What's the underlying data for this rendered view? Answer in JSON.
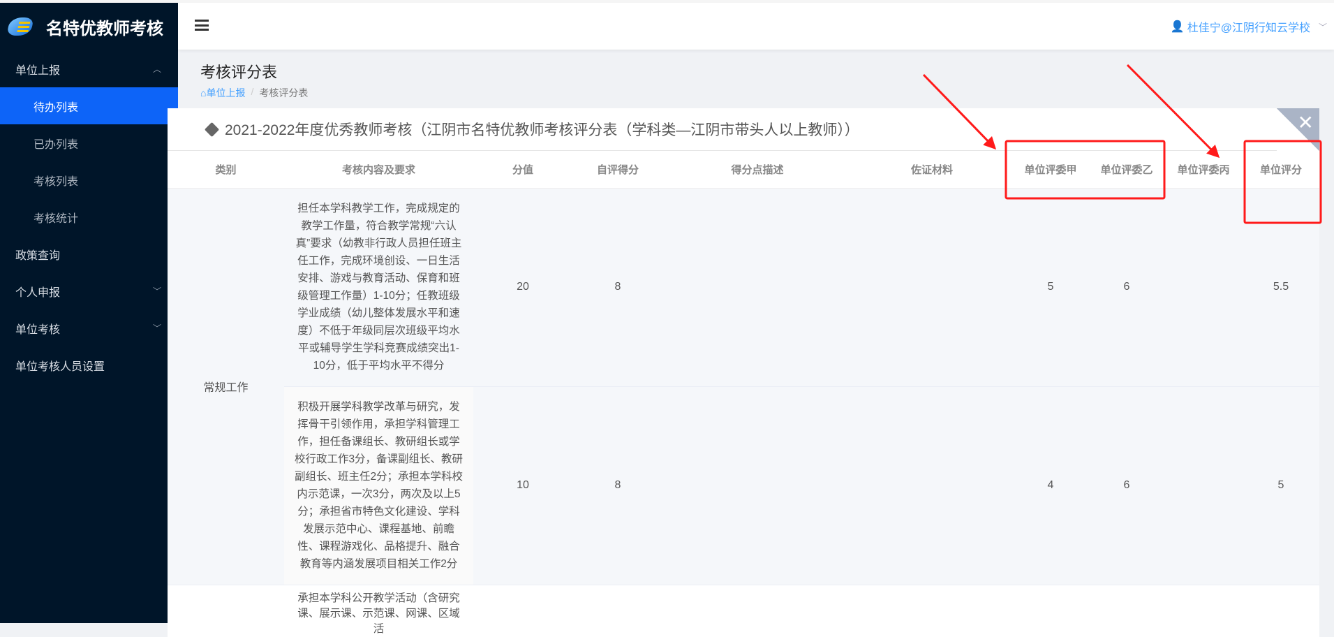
{
  "app": {
    "title": "名特优教师考核"
  },
  "sidebar": {
    "items": [
      {
        "label": "单位上报",
        "expanded": true
      },
      {
        "label": "待办列表",
        "active": true
      },
      {
        "label": "已办列表"
      },
      {
        "label": "考核列表"
      },
      {
        "label": "考核统计"
      },
      {
        "label": "政策查询"
      },
      {
        "label": "个人申报"
      },
      {
        "label": "单位考核"
      },
      {
        "label": "单位考核人员设置"
      }
    ]
  },
  "header": {
    "user": "杜佳宁@江阴行知云学校"
  },
  "page": {
    "title": "考核评分表",
    "breadcrumb": [
      "单位上报",
      "考核评分表"
    ],
    "sep": "/"
  },
  "card": {
    "title": "2021-2022年度优秀教师考核（江阴市名特优教师考核评分表（学科类—江阴市带头人以上教师））",
    "close": "✕"
  },
  "table": {
    "headers": [
      "类别",
      "考核内容及要求",
      "分值",
      "自评得分",
      "得分点描述",
      "佐证材料",
      "单位评委甲",
      "单位评委乙",
      "单位评委丙",
      "单位评分"
    ],
    "category": "常规工作",
    "rows": [
      {
        "content": "担任本学科教学工作，完成规定的教学工作量，符合教学常规“六认真”要求（幼教非行政人员担任班主任工作，完成环境创设、一日生活安排、游戏与教育活动、保育和班级管理工作量）1-10分；任教班级学业成绩（幼儿整体发展水平和速度）不低于年级同层次班级平均水平或辅导学生学科竞赛成绩突出1-10分，低于平均水平不得分",
        "score": "20",
        "self": "8",
        "desc": "",
        "evidence": "",
        "a": "5",
        "b": "6",
        "c": "",
        "unit": "5.5"
      },
      {
        "content": "积极开展学科教学改革与研究，发挥骨干引领作用，承担学科管理工作，担任备课组长、教研组长或学校行政工作3分，备课副组长、教研副组长、班主任2分；承担本学科校内示范课，一次3分，两次及以上5分；承担省市特色文化建设、学科发展示范中心、课程基地、前瞻性、课程游戏化、品格提升、融合教育等内涵发展项目相关工作2分",
        "score": "10",
        "self": "8",
        "desc": "",
        "evidence": "",
        "a": "4",
        "b": "6",
        "c": "",
        "unit": "5"
      },
      {
        "content": "承担本学科公开教学活动（含研究课、展示课、示范课、网课、区域活"
      }
    ]
  },
  "colors": {
    "sidebar": "#001529",
    "active": "#0d64f8",
    "link": "#409eff",
    "annotation": "#ff1a1a"
  }
}
